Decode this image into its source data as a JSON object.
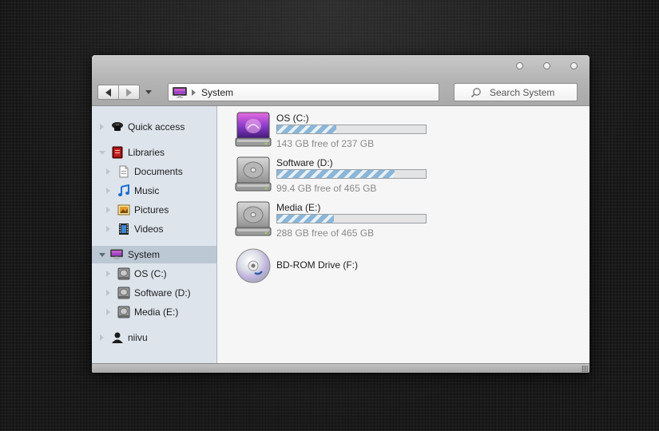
{
  "window": {
    "controls": [
      "minimize",
      "maximize",
      "close"
    ],
    "accent_color": "#8bb6d8"
  },
  "toolbar": {
    "back_icon": "back-arrow-icon",
    "forward_icon": "forward-arrow-icon",
    "recent_icon": "chevron-down-icon"
  },
  "address": {
    "icon": "imac-computer-icon",
    "path": [
      "System"
    ]
  },
  "search": {
    "placeholder": "Search System",
    "icon": "search-icon"
  },
  "sidebar": {
    "groups": [
      {
        "label": "Quick access",
        "icon": "quick-access-icon",
        "expanded": false,
        "children": []
      },
      {
        "label": "Libraries",
        "icon": "libraries-icon",
        "expanded": true,
        "children": [
          {
            "label": "Documents",
            "icon": "documents-icon"
          },
          {
            "label": "Music",
            "icon": "music-icon"
          },
          {
            "label": "Pictures",
            "icon": "pictures-icon"
          },
          {
            "label": "Videos",
            "icon": "videos-icon"
          }
        ]
      },
      {
        "label": "System",
        "icon": "imac-computer-icon",
        "expanded": true,
        "selected": true,
        "children": [
          {
            "label": "OS (C:)",
            "icon": "hard-drive-icon"
          },
          {
            "label": "Software (D:)",
            "icon": "hard-drive-icon"
          },
          {
            "label": "Media (E:)",
            "icon": "hard-drive-icon"
          }
        ]
      },
      {
        "label": "niivu",
        "icon": "user-icon",
        "expanded": false,
        "children": []
      }
    ]
  },
  "drives": [
    {
      "name": "OS (C:)",
      "free_text": "143 GB free of 237 GB",
      "used_fraction": 0.4,
      "icon": "os-drive-icon"
    },
    {
      "name": "Software (D:)",
      "free_text": "99.4 GB free of 465 GB",
      "used_fraction": 0.79,
      "icon": "hard-drive-icon"
    },
    {
      "name": "Media (E:)",
      "free_text": "288 GB free of 465 GB",
      "used_fraction": 0.38,
      "icon": "hard-drive-icon"
    },
    {
      "name": "BD-ROM Drive (F:)",
      "free_text": "",
      "used_fraction": null,
      "icon": "blu-ray-disc-icon"
    }
  ]
}
